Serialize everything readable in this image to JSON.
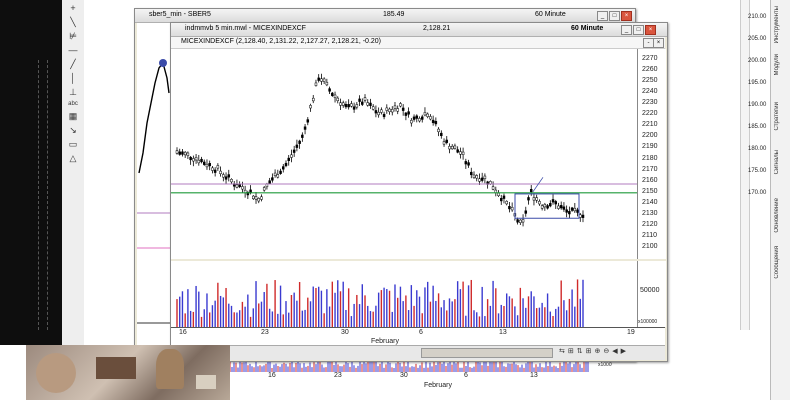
{
  "back_window": {
    "title": "sber5_min - SBER5",
    "price": "185.49",
    "interval": "60 Minute"
  },
  "front_window": {
    "title": "indmmvb 5 min.mwl - MICEXINDEXCF",
    "price": "2,128.21",
    "interval": "60 Minute",
    "symbol_line": "MICEXINDEXCF (2,128.40, 2,131.22, 2,127.27, 2,128.21, -0.20)",
    "yticks": [
      "2270",
      "2260",
      "2250",
      "2240",
      "2230",
      "2220",
      "2210",
      "2200",
      "2190",
      "2180",
      "2170",
      "2160",
      "2150",
      "2140",
      "2130",
      "2120",
      "2110",
      "2100"
    ],
    "volume_tick": "50000",
    "volume_unit": "x100000",
    "xticks": [
      "16",
      "23",
      "30",
      "6",
      "13",
      "19"
    ],
    "month_label": "February"
  },
  "back_xaxis": {
    "xticks": [
      "16",
      "23",
      "30",
      "6",
      "13"
    ],
    "month_label": "February",
    "volume_unit": "x1000"
  },
  "back_right_ticks": [
    "210.00",
    "205.00",
    "200.00",
    "195.00",
    "190.00",
    "185.00",
    "180.00",
    "175.00",
    "170.00"
  ],
  "toolbar_icons": [
    "plus-icon",
    "line-icon",
    "diagonal-line-icon",
    "fib-icon",
    "horizontal-line-icon",
    "vertical-line-icon",
    "text-abc-icon",
    "grid-icon",
    "arrow-icon",
    "ellipse-icon",
    "rectangle-icon",
    "triangle-icon"
  ],
  "toolbar_text": {
    "abc": "abc"
  },
  "side_tabs": [
    "Инструменты",
    "Модули",
    "Стратегии",
    "Сигналы",
    "Обновление",
    "Сообщения"
  ],
  "colors": {
    "candle": "#000000",
    "green_line": "#1f9a3a",
    "violet_line": "#b07bbf",
    "volume_blue": "#3a3ad0",
    "volume_red": "#d02a2a",
    "select_box": "#3a4aa8"
  }
}
